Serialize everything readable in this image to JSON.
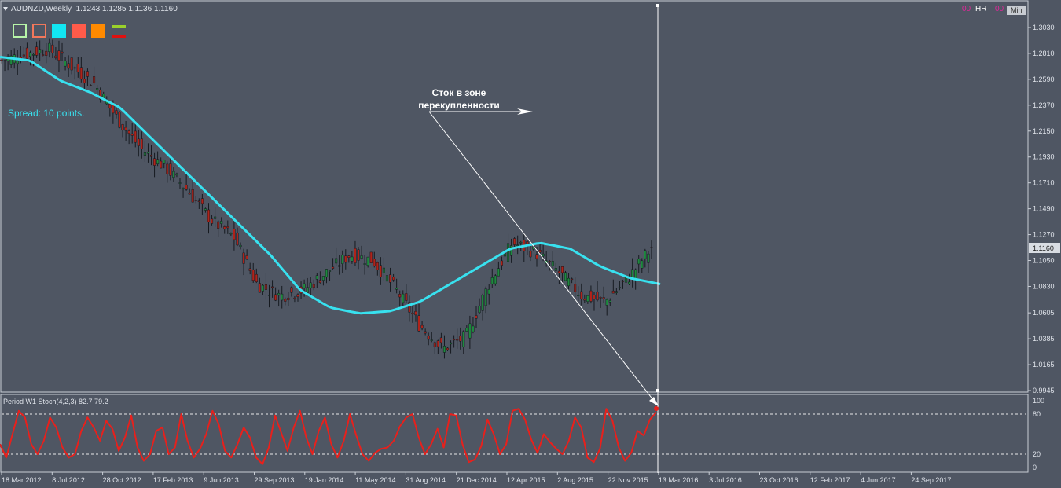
{
  "header": {
    "symbol": "AUDNZD,Weekly",
    "ohlc": "1.1243 1.1285 1.1136 1.1160"
  },
  "toolbar": {
    "swatches": [
      {
        "name": "light-green-outline-swatch",
        "border": "#b7f5a8",
        "fill": "transparent"
      },
      {
        "name": "salmon-outline-swatch",
        "border": "#f2775b",
        "fill": "transparent"
      },
      {
        "name": "cyan-swatch",
        "border": "#12e6f2",
        "fill": "#12e6f2"
      },
      {
        "name": "tomato-swatch",
        "border": "#ff5b4a",
        "fill": "#ff5b4a"
      },
      {
        "name": "orange-swatch",
        "border": "#ff8a00",
        "fill": "#ff8a00"
      }
    ],
    "line_icon_colors": [
      "#9ad12b",
      "#e01010"
    ]
  },
  "top_right": {
    "hr": "HR",
    "min": "Min",
    "accent": "#e0289a"
  },
  "spread_text": "Spread: 10 points.",
  "annotation": {
    "line1": "Сток в зоне",
    "line2": "перекупленности"
  },
  "price_label": "1.1160",
  "colors": {
    "background": "#4f5663",
    "ma": "#38e1ef",
    "bull": "#1e8a3e",
    "bear": "#b0231a",
    "stoch": "#e8201c",
    "text": "#dfe3ea",
    "grid_line": "#e8e8e8"
  },
  "chart_data": [
    {
      "type": "line",
      "title": "AUDNZD,Weekly",
      "note": "weekly candlesticks with a moving average (cyan)",
      "x": [
        "18 Mar 2012",
        "8 Jul 2012",
        "28 Oct 2012",
        "17 Feb 2013",
        "9 Jun 2013",
        "29 Sep 2013",
        "19 Jan 2014",
        "11 May 2014",
        "31 Aug 2014",
        "21 Dec 2014",
        "12 Apr 2015",
        "2 Aug 2015",
        "22 Nov 2015",
        "13 Mar 2016",
        "3 Jul 2016",
        "23 Oct 2016",
        "12 Feb 2017",
        "4 Jun 2017",
        "24 Sep 2017"
      ],
      "y_ticks": [
        "1.3030",
        "1.2810",
        "1.2590",
        "1.2370",
        "1.2150",
        "1.1930",
        "1.1710",
        "1.1490",
        "1.1270",
        "1.1050",
        "1.0830",
        "1.0605",
        "1.0385",
        "1.0165",
        "0.9945"
      ],
      "ylim": [
        0.9945,
        1.303
      ],
      "series": [
        {
          "values": [
            1.278,
            1.275,
            1.258,
            1.248,
            1.235,
            1.21,
            1.185,
            1.16,
            1.135,
            1.11,
            1.08,
            1.065,
            1.06,
            1.062,
            1.07,
            1.085,
            1.1,
            1.115,
            1.12,
            1.115,
            1.1,
            1.09,
            1.085
          ]
        },
        {
          "values": [
            1.275,
            1.28,
            1.285,
            1.27,
            1.255,
            1.225,
            1.2,
            1.185,
            1.165,
            1.14,
            1.125,
            1.085,
            1.075,
            1.08,
            1.095,
            1.11,
            1.105,
            1.08,
            1.05,
            1.03,
            1.04,
            1.085,
            1.12,
            1.112,
            1.095,
            1.075,
            1.07,
            1.09,
            1.116
          ]
        }
      ],
      "series_x": [
        {
          "x": [
            "18 Mar 2012",
            "8 Jul 2012",
            "28 Oct 2012",
            "17 Feb 2013",
            "9 Jun 2013",
            "29 Sep 2013",
            "19 Jan 2014",
            "11 May 2014",
            "31 Aug 2014",
            "21 Dec 2014",
            "12 Apr 2015",
            "2 Aug 2015",
            "22 Nov 2015",
            "13 Mar 2016"
          ]
        }
      ]
    },
    {
      "type": "line",
      "title": "Period W1 Stoch(4,2,3) 82.7 79.2",
      "ylim": [
        0,
        100
      ],
      "y_ticks": [
        "100",
        "80",
        "20",
        "0"
      ],
      "levels": [
        80,
        20
      ],
      "series": [
        {
          "values": [
            35,
            15,
            50,
            85,
            75,
            35,
            20,
            40,
            75,
            60,
            30,
            15,
            20,
            55,
            75,
            60,
            40,
            70,
            58,
            25,
            45,
            78,
            30,
            10,
            20,
            55,
            60,
            20,
            30,
            80,
            40,
            15,
            28,
            50,
            85,
            65,
            25,
            15,
            35,
            60,
            45,
            15,
            5,
            30,
            78,
            52,
            25,
            60,
            85,
            45,
            20,
            55,
            75,
            35,
            15,
            40,
            80,
            48,
            20,
            10,
            22,
            28,
            30,
            40,
            62,
            75,
            80,
            45,
            20,
            35,
            58,
            30,
            80,
            78,
            35,
            8,
            12,
            32,
            72,
            50,
            20,
            35,
            85,
            88,
            72,
            42,
            22,
            50,
            38,
            28,
            20,
            40,
            75,
            60,
            15,
            8,
            28,
            88,
            70,
            30,
            10,
            22,
            55,
            48,
            72,
            82.7
          ]
        }
      ]
    }
  ]
}
